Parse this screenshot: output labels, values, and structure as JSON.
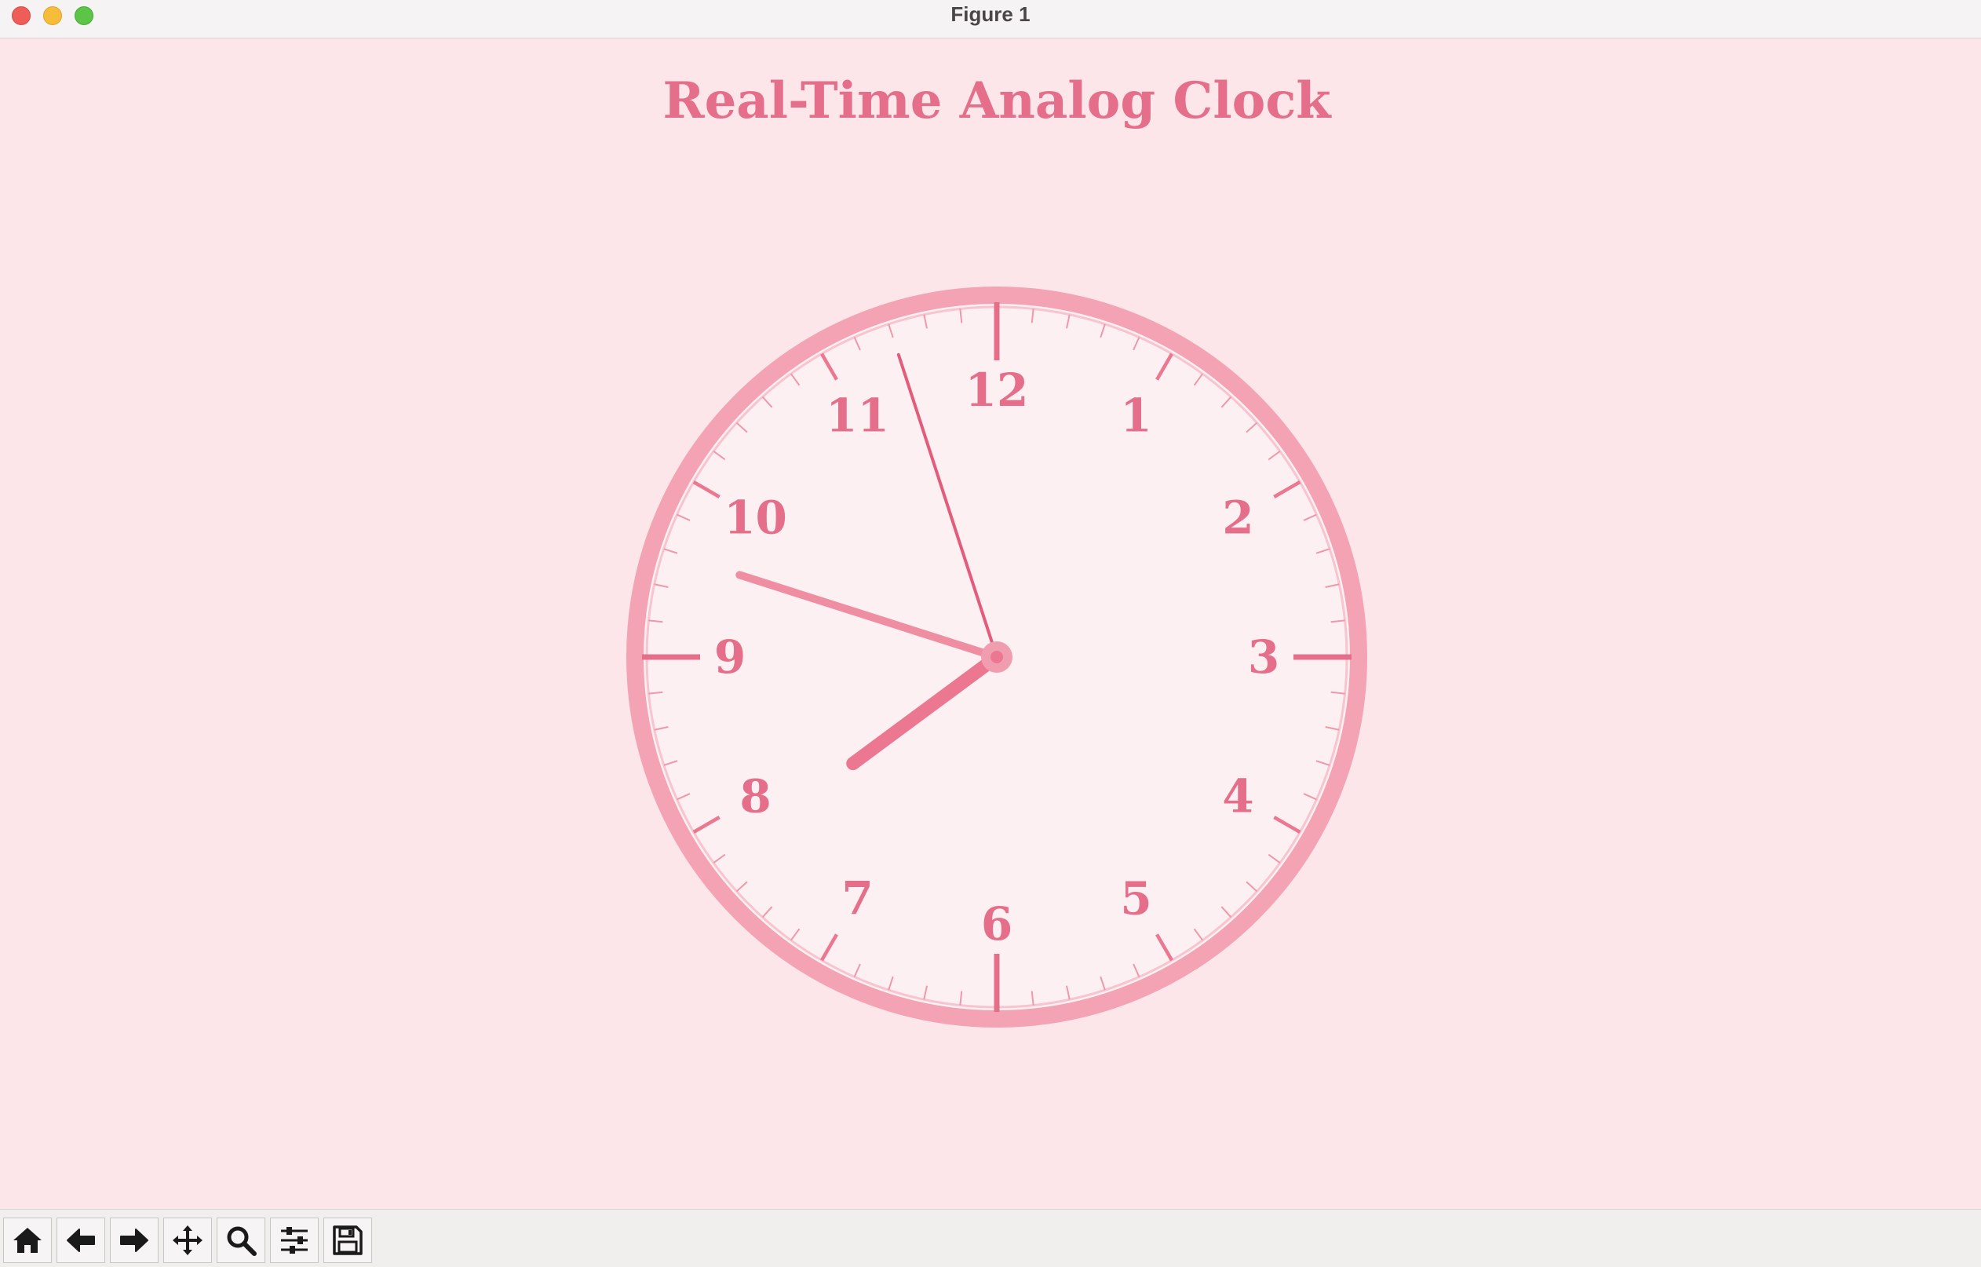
{
  "window": {
    "title": "Figure 1"
  },
  "figure": {
    "title": "Real-Time Analog Clock"
  },
  "clock": {
    "numbers": [
      "12",
      "1",
      "2",
      "3",
      "4",
      "5",
      "6",
      "7",
      "8",
      "9",
      "10",
      "11"
    ],
    "time": {
      "hour": 7,
      "minute": 47,
      "second": 57
    }
  },
  "toolbar": {
    "buttons": [
      {
        "name": "home-icon"
      },
      {
        "name": "back-arrow-icon"
      },
      {
        "name": "forward-arrow-icon"
      },
      {
        "name": "pan-icon"
      },
      {
        "name": "zoom-icon"
      },
      {
        "name": "configure-subplots-icon"
      },
      {
        "name": "save-icon"
      }
    ]
  },
  "colors": {
    "background": "#fce6ea",
    "face": "#fdf0f2",
    "rim": "#f3a3b3",
    "accent": "#e56f8a",
    "hour_hand": "#ec7790",
    "minute_hand": "#ef8ea2",
    "second_hand": "#e35c7c"
  }
}
